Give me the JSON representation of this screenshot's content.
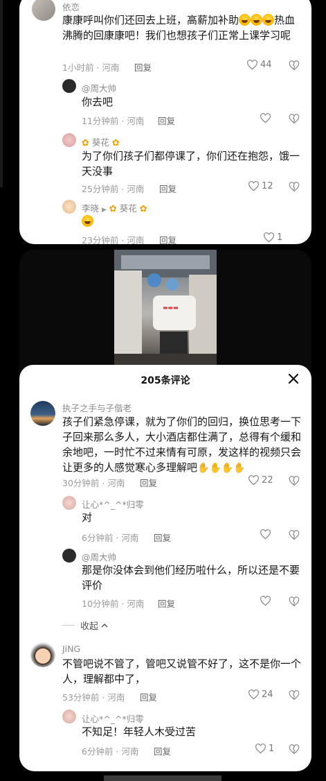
{
  "card1": {
    "top_comment": {
      "user": "依恋",
      "text_a": "康康呼叫你们还回去上班，高薪加补助",
      "text_b": "热血沸腾的回康康吧！我们也想孩子们正常上课学习呢",
      "time": "1小时前 · 河南",
      "reply": "回复",
      "likes": "44"
    },
    "replies": [
      {
        "user": "@周大帅",
        "text": "你去吧",
        "time": "11分钟前 · 河南",
        "reply": "回复",
        "likes": ""
      },
      {
        "user": "葵花",
        "text": "为了你们孩子们都停课了，你们还在抱怨，饿一天没事",
        "time": "25分钟前 · 河南",
        "reply": "回复",
        "likes": "12"
      },
      {
        "user": "李晓",
        "target": "葵花",
        "text": "",
        "time": "23分钟前 · 河南",
        "reply": "回复",
        "likes": "1"
      }
    ]
  },
  "card2": {
    "header_title": "205条评论",
    "c1": {
      "user": "执子之手与子偕老",
      "text": "孩子们紧急停课，就为了你们的回归，换位思考一下子回来那么多人，大小酒店都住满了，总得有个缓和余地吧，一时忙不过来情有可原，发这样的视频只会让更多的人感觉寒心多理解吧",
      "time": "30分钟前 · 河南",
      "reply": "回复",
      "likes": "22"
    },
    "c1_replies": [
      {
        "user": "让心*^_^*归零",
        "text": "对",
        "time": "6分钟前 · 河南",
        "reply": "回复",
        "likes": ""
      },
      {
        "user": "@周大帅",
        "text": "那是你没体会到他们经历啦什么，所以还是不要评价",
        "time": "10分钟前 · 河南",
        "reply": "回复",
        "likes": ""
      }
    ],
    "collapse": "收起",
    "c2": {
      "user": "JiNG",
      "text": "不管吧说不管了，管吧又说管不好了，这不是你一个人，理解都中了，",
      "time": "53分钟前 · 河南",
      "reply": "回复",
      "likes": "24"
    },
    "c2_replies": [
      {
        "user": "让心*^_^*归零",
        "text": "不知足！年轻人木受过苦",
        "time": "6分钟前 · 河南",
        "reply": "回复",
        "likes": "1"
      }
    ]
  },
  "colors": {
    "accent": "#fe2c55",
    "meta": "#9a9a9a",
    "background": "#000000"
  },
  "icons": [
    "heart-icon",
    "dislike-heart-icon",
    "close-icon",
    "chevron-up-icon",
    "play-triangle-icon"
  ]
}
